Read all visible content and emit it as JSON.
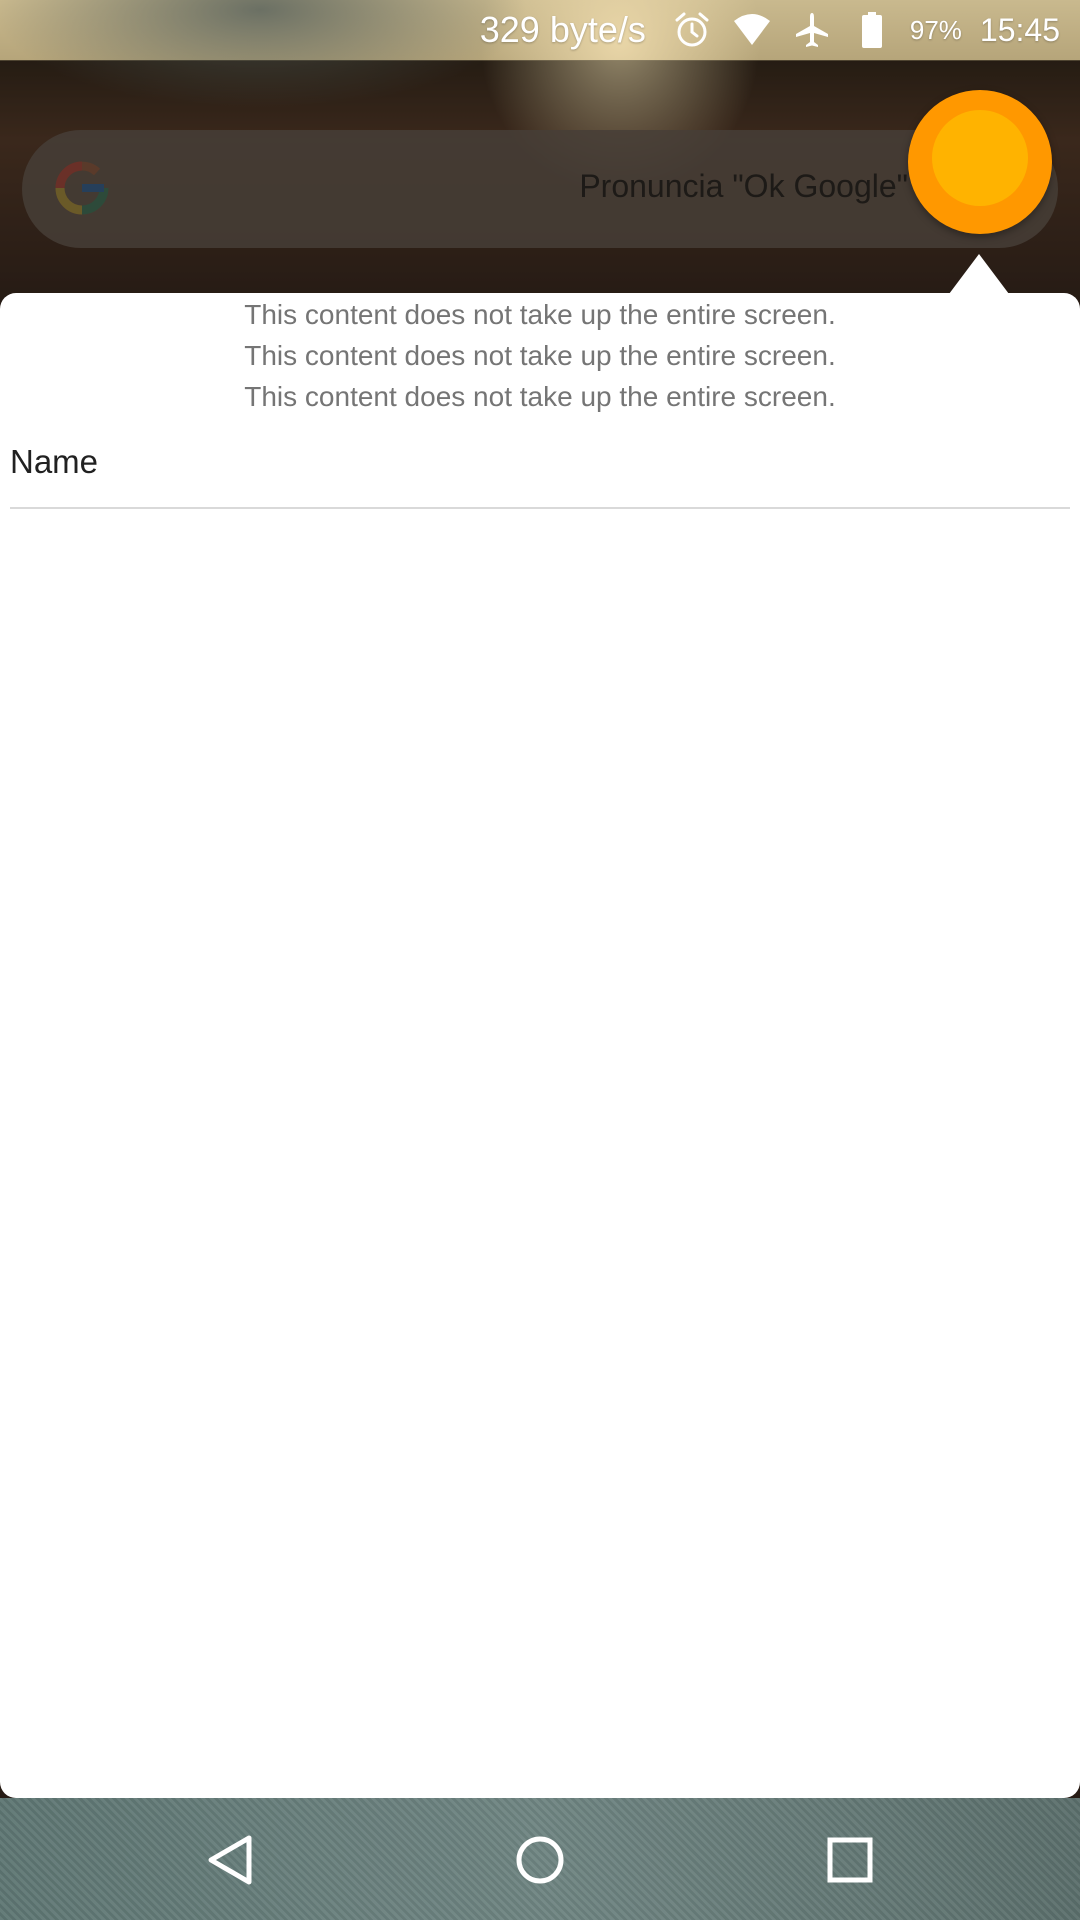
{
  "status_bar": {
    "net_speed": "329 byte/s",
    "battery_percent": "97%",
    "time": "15:45",
    "icons": [
      "alarm-icon",
      "wifi-icon",
      "airplane-icon",
      "battery-icon"
    ]
  },
  "search_bar": {
    "hint": "Pronuncia \"Ok Google\"",
    "logo_icon": "google-g-icon"
  },
  "floating_button": {
    "icon": "orange-circle-bubble-icon",
    "colors": {
      "outer": "#ff9800",
      "inner": "#ffb300"
    }
  },
  "popup": {
    "messages": [
      "This content does not take up the entire screen.",
      "This content does not take up the entire screen.",
      "This content does not take up the entire screen."
    ],
    "name_label": "Name"
  },
  "nav_bar": {
    "back_icon": "back-triangle-icon",
    "home_icon": "home-circle-icon",
    "recents_icon": "recents-square-icon"
  }
}
